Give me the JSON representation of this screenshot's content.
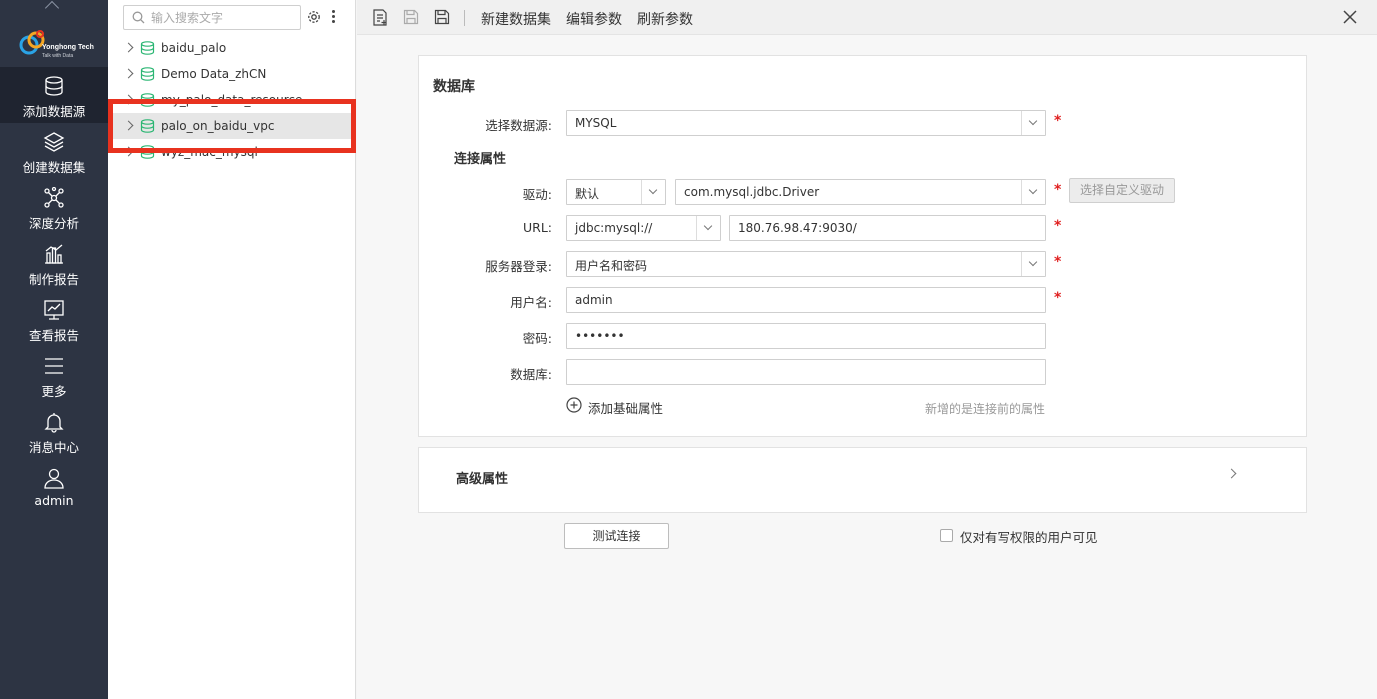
{
  "nav": {
    "logo_name": "Yonghong Tech",
    "logo_tagline": "Talk with Data",
    "items": [
      {
        "label": "添加数据源",
        "icon": "database-icon"
      },
      {
        "label": "创建数据集",
        "icon": "layers-icon"
      },
      {
        "label": "深度分析",
        "icon": "network-icon"
      },
      {
        "label": "制作报告",
        "icon": "bar-chart-icon"
      },
      {
        "label": "查看报告",
        "icon": "monitor-chart-icon"
      },
      {
        "label": "更多",
        "icon": "menu-icon"
      },
      {
        "label": "消息中心",
        "icon": "bell-icon"
      },
      {
        "label": "admin",
        "icon": "user-icon"
      }
    ]
  },
  "tree": {
    "search_placeholder": "输入搜索文字",
    "items": [
      {
        "label": "baidu_palo"
      },
      {
        "label": "Demo Data_zhCN"
      },
      {
        "label": "my_palo_data_resource"
      },
      {
        "label": "palo_on_baidu_vpc"
      },
      {
        "label": "wyz_mac_mysql"
      }
    ]
  },
  "toolbar": {
    "new_dataset": "新建数据集",
    "edit_params": "编辑参数",
    "refresh_params": "刷新参数"
  },
  "form": {
    "section_title": "数据库",
    "datasource_label": "选择数据源:",
    "datasource_value": "MYSQL",
    "conn_props_title": "连接属性",
    "driver_label": "驱动:",
    "driver_mode": "默认",
    "driver_class": "com.mysql.jdbc.Driver",
    "custom_driver_button": "选择自定义驱动",
    "url_label": "URL:",
    "url_prefix": "jdbc:mysql://",
    "url_host": "180.76.98.47:9030/",
    "server_login_label": "服务器登录:",
    "server_login_value": "用户名和密码",
    "username_label": "用户名:",
    "username_value": "admin",
    "password_label": "密码:",
    "password_value": "•••••••",
    "database_label": "数据库:",
    "database_value": "",
    "add_basic_prop": "添加基础属性",
    "add_prop_hint": "新增的是连接前的属性",
    "required_mark": "*"
  },
  "advanced": {
    "title": "高级属性"
  },
  "footer": {
    "test_connection": "测试连接",
    "write_permission_only": "仅对有写权限的用户可见"
  }
}
